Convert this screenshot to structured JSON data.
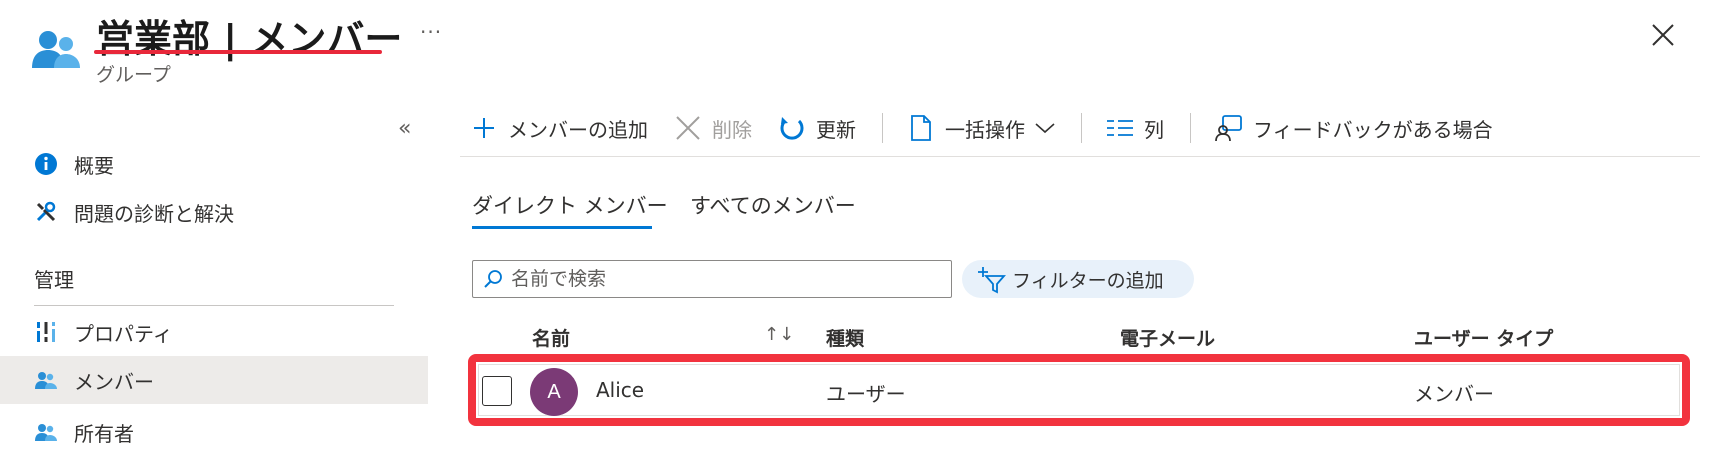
{
  "header": {
    "title": "営業部 | メンバー",
    "subtitle": "グループ",
    "more": "···"
  },
  "sidebar": {
    "collapse": "«",
    "items": [
      {
        "label": "概要"
      },
      {
        "label": "問題の診断と解決"
      },
      {
        "label": "プロパティ"
      },
      {
        "label": "メンバー"
      },
      {
        "label": "所有者"
      }
    ],
    "section": "管理"
  },
  "toolbar": {
    "add_member": "メンバーの追加",
    "delete": "削除",
    "refresh": "更新",
    "bulk": "一括操作",
    "columns": "列",
    "feedback": "フィードバックがある場合"
  },
  "tabs": [
    {
      "label": "ダイレクト メンバー",
      "active": true
    },
    {
      "label": "すべてのメンバー",
      "active": false
    }
  ],
  "search": {
    "placeholder": "名前で検索"
  },
  "filter": {
    "label": "フィルターの追加"
  },
  "table": {
    "headers": [
      "名前",
      "種類",
      "電子メール",
      "ユーザー タイプ"
    ],
    "sort_icon": "↑↓",
    "rows": [
      {
        "initial": "A",
        "name": "Alice",
        "type": "ユーザー",
        "email": "",
        "user_type": "メンバー"
      }
    ]
  },
  "colors": {
    "accent": "#0078d4",
    "highlight": "#f2333e",
    "avatar": "#7b3a76"
  }
}
